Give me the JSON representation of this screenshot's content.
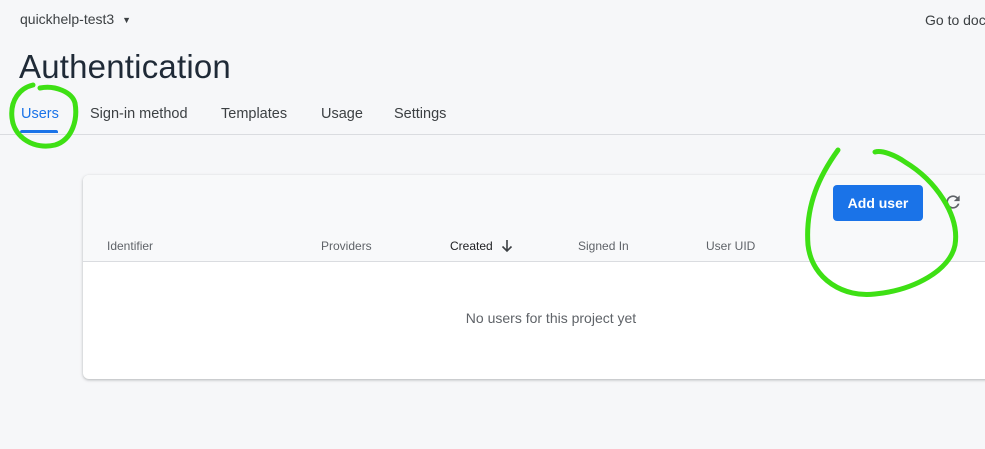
{
  "header": {
    "project_name": "quickhelp-test3",
    "docs_link": "Go to doc"
  },
  "page_title": "Authentication",
  "tabs": [
    {
      "label": "Users",
      "active": true
    },
    {
      "label": "Sign-in method",
      "active": false
    },
    {
      "label": "Templates",
      "active": false
    },
    {
      "label": "Usage",
      "active": false
    },
    {
      "label": "Settings",
      "active": false
    }
  ],
  "users_table": {
    "add_user_label": "Add user",
    "columns": [
      "Identifier",
      "Providers",
      "Created",
      "Signed In",
      "User UID"
    ],
    "sorted_column": "Created",
    "empty_message": "No users for this project yet"
  },
  "colors": {
    "accent": "#1a73e8",
    "annotation": "#3ee014"
  },
  "icons": [
    "chevron-down-icon",
    "refresh-icon",
    "arrow-down-icon"
  ]
}
